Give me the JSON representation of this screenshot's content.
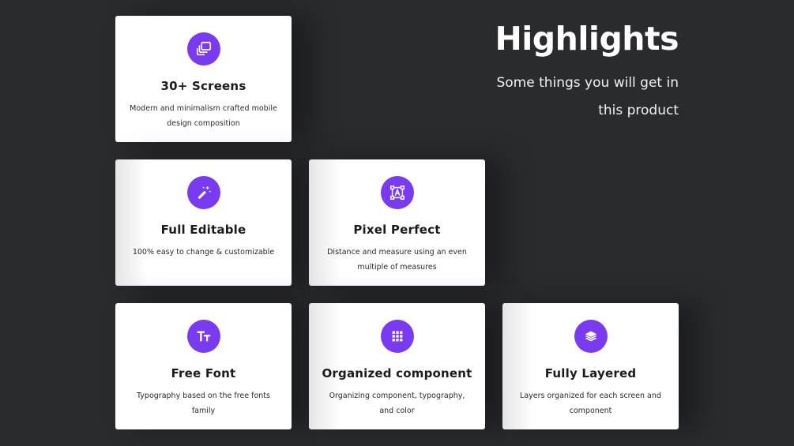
{
  "header": {
    "title": "Highlights",
    "subtitle": "Some things you will get in this product"
  },
  "cards": [
    {
      "title": "30+ Screens",
      "desc": "Modern and minimalism crafted mobile design composition",
      "icon": "screens-icon"
    },
    {
      "title": "Full Editable",
      "desc": "100% easy to change & customizable",
      "icon": "magic-wand-icon"
    },
    {
      "title": "Pixel Perfect",
      "desc": "Distance and measure using an even multiple of measures",
      "icon": "pixel-frame-icon"
    },
    {
      "title": "Free Font",
      "desc": "Typography based on the free fonts family",
      "icon": "font-icon"
    },
    {
      "title": "Organized component",
      "desc": "Organizing component, typography, and color",
      "icon": "grid-icon"
    },
    {
      "title": "Fully Layered",
      "desc": "Layers organized for each screen and component",
      "icon": "layers-icon"
    }
  ],
  "colors": {
    "background": "#2a2b2f",
    "accent": "#7a3bf0",
    "card": "#ffffff"
  }
}
